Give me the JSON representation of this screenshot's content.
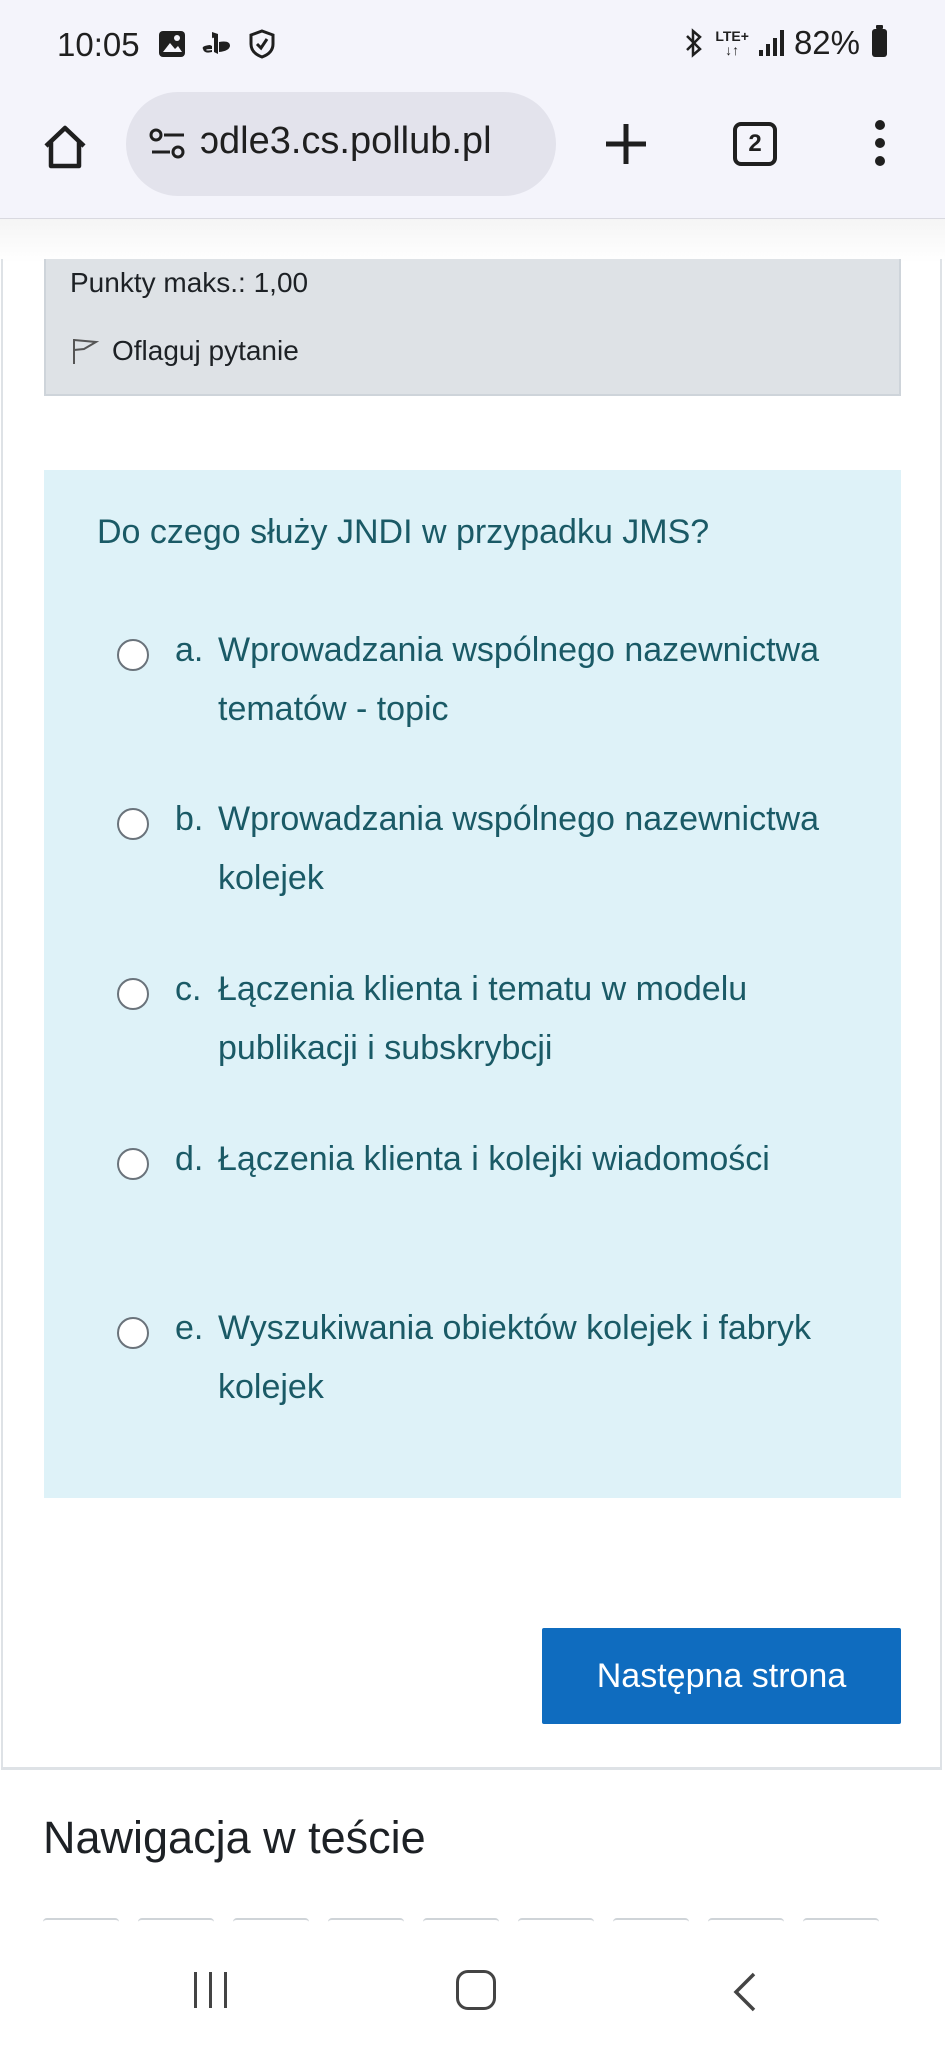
{
  "status_bar": {
    "time": "10:05",
    "left_icons": [
      "gallery-icon",
      "playstation-icon",
      "shield-icon"
    ],
    "lte": "LTE+",
    "battery": "82%"
  },
  "browser": {
    "url": "ɔdle3.cs.pollub.pl",
    "tab_count": "2"
  },
  "question_info": {
    "points": "Punkty maks.: 1,00",
    "flag_label": "Oflaguj pytanie"
  },
  "question": {
    "text": "Do czego służy JNDI w przypadku JMS?",
    "answers": [
      {
        "letter": "a.",
        "text": "Wprowadzania wspólnego nazewnictwa tematów - topic"
      },
      {
        "letter": "b.",
        "text": "Wprowadzania wspólnego nazewnictwa kolejek"
      },
      {
        "letter": "c.",
        "text": "Łączenia klienta i tematu w modelu publikacji i subskrybcji"
      },
      {
        "letter": "d.",
        "text": "Łączenia klienta i kolejki wiadomości"
      },
      {
        "letter": "e.",
        "text": "Wyszukiwania obiektów kolejek i fabryk kolejek"
      }
    ]
  },
  "next_button": "Następna strona",
  "quiz_nav": {
    "title": "Nawigacja w teście"
  },
  "colors": {
    "question_bg": "#def2f8",
    "question_text": "#1a5a66",
    "primary_button": "#0f6cbf",
    "info_bg": "#dee2e6"
  }
}
